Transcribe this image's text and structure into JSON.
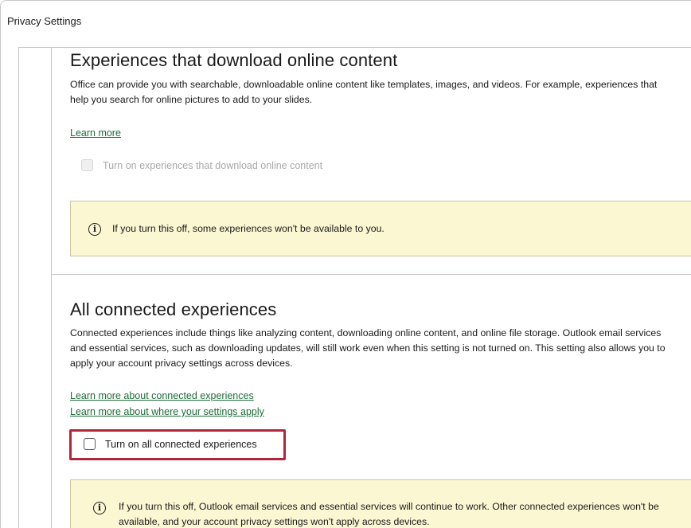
{
  "window": {
    "title": "Privacy Settings"
  },
  "download_section": {
    "heading": "Experiences that download online content",
    "description": "Office can provide you with searchable, downloadable online content like templates, images, and videos. For example, experiences that help you search for online pictures to add to your slides.",
    "learn_more": "Learn more",
    "checkbox_label": "Turn on experiences that download online content",
    "checkbox_checked": false,
    "checkbox_enabled": false,
    "info_icon": "info-icon",
    "info_text": "If you turn this off, some experiences won't be available to you."
  },
  "connected_section": {
    "heading": "All connected experiences",
    "description": "Connected experiences include things like analyzing content, downloading online content, and online file storage. Outlook email services and essential services, such as downloading updates, will still work even when this setting is not turned on. This setting also allows you to apply your account privacy settings across devices.",
    "link_connected": "Learn more about connected experiences",
    "link_settings": "Learn more about where your settings apply",
    "checkbox_label": "Turn on all connected experiences",
    "checkbox_checked": false,
    "checkbox_enabled": true,
    "highlight_color": "#b0263a",
    "info_icon": "info-icon",
    "info_text": "If you turn this off, Outlook email services and essential services will continue to work. Other connected experiences won't be available, and your account privacy settings won't apply across devices."
  },
  "colors": {
    "link": "#1d6b3a",
    "info_background": "#fbf7d3",
    "highlight": "#b0263a"
  }
}
